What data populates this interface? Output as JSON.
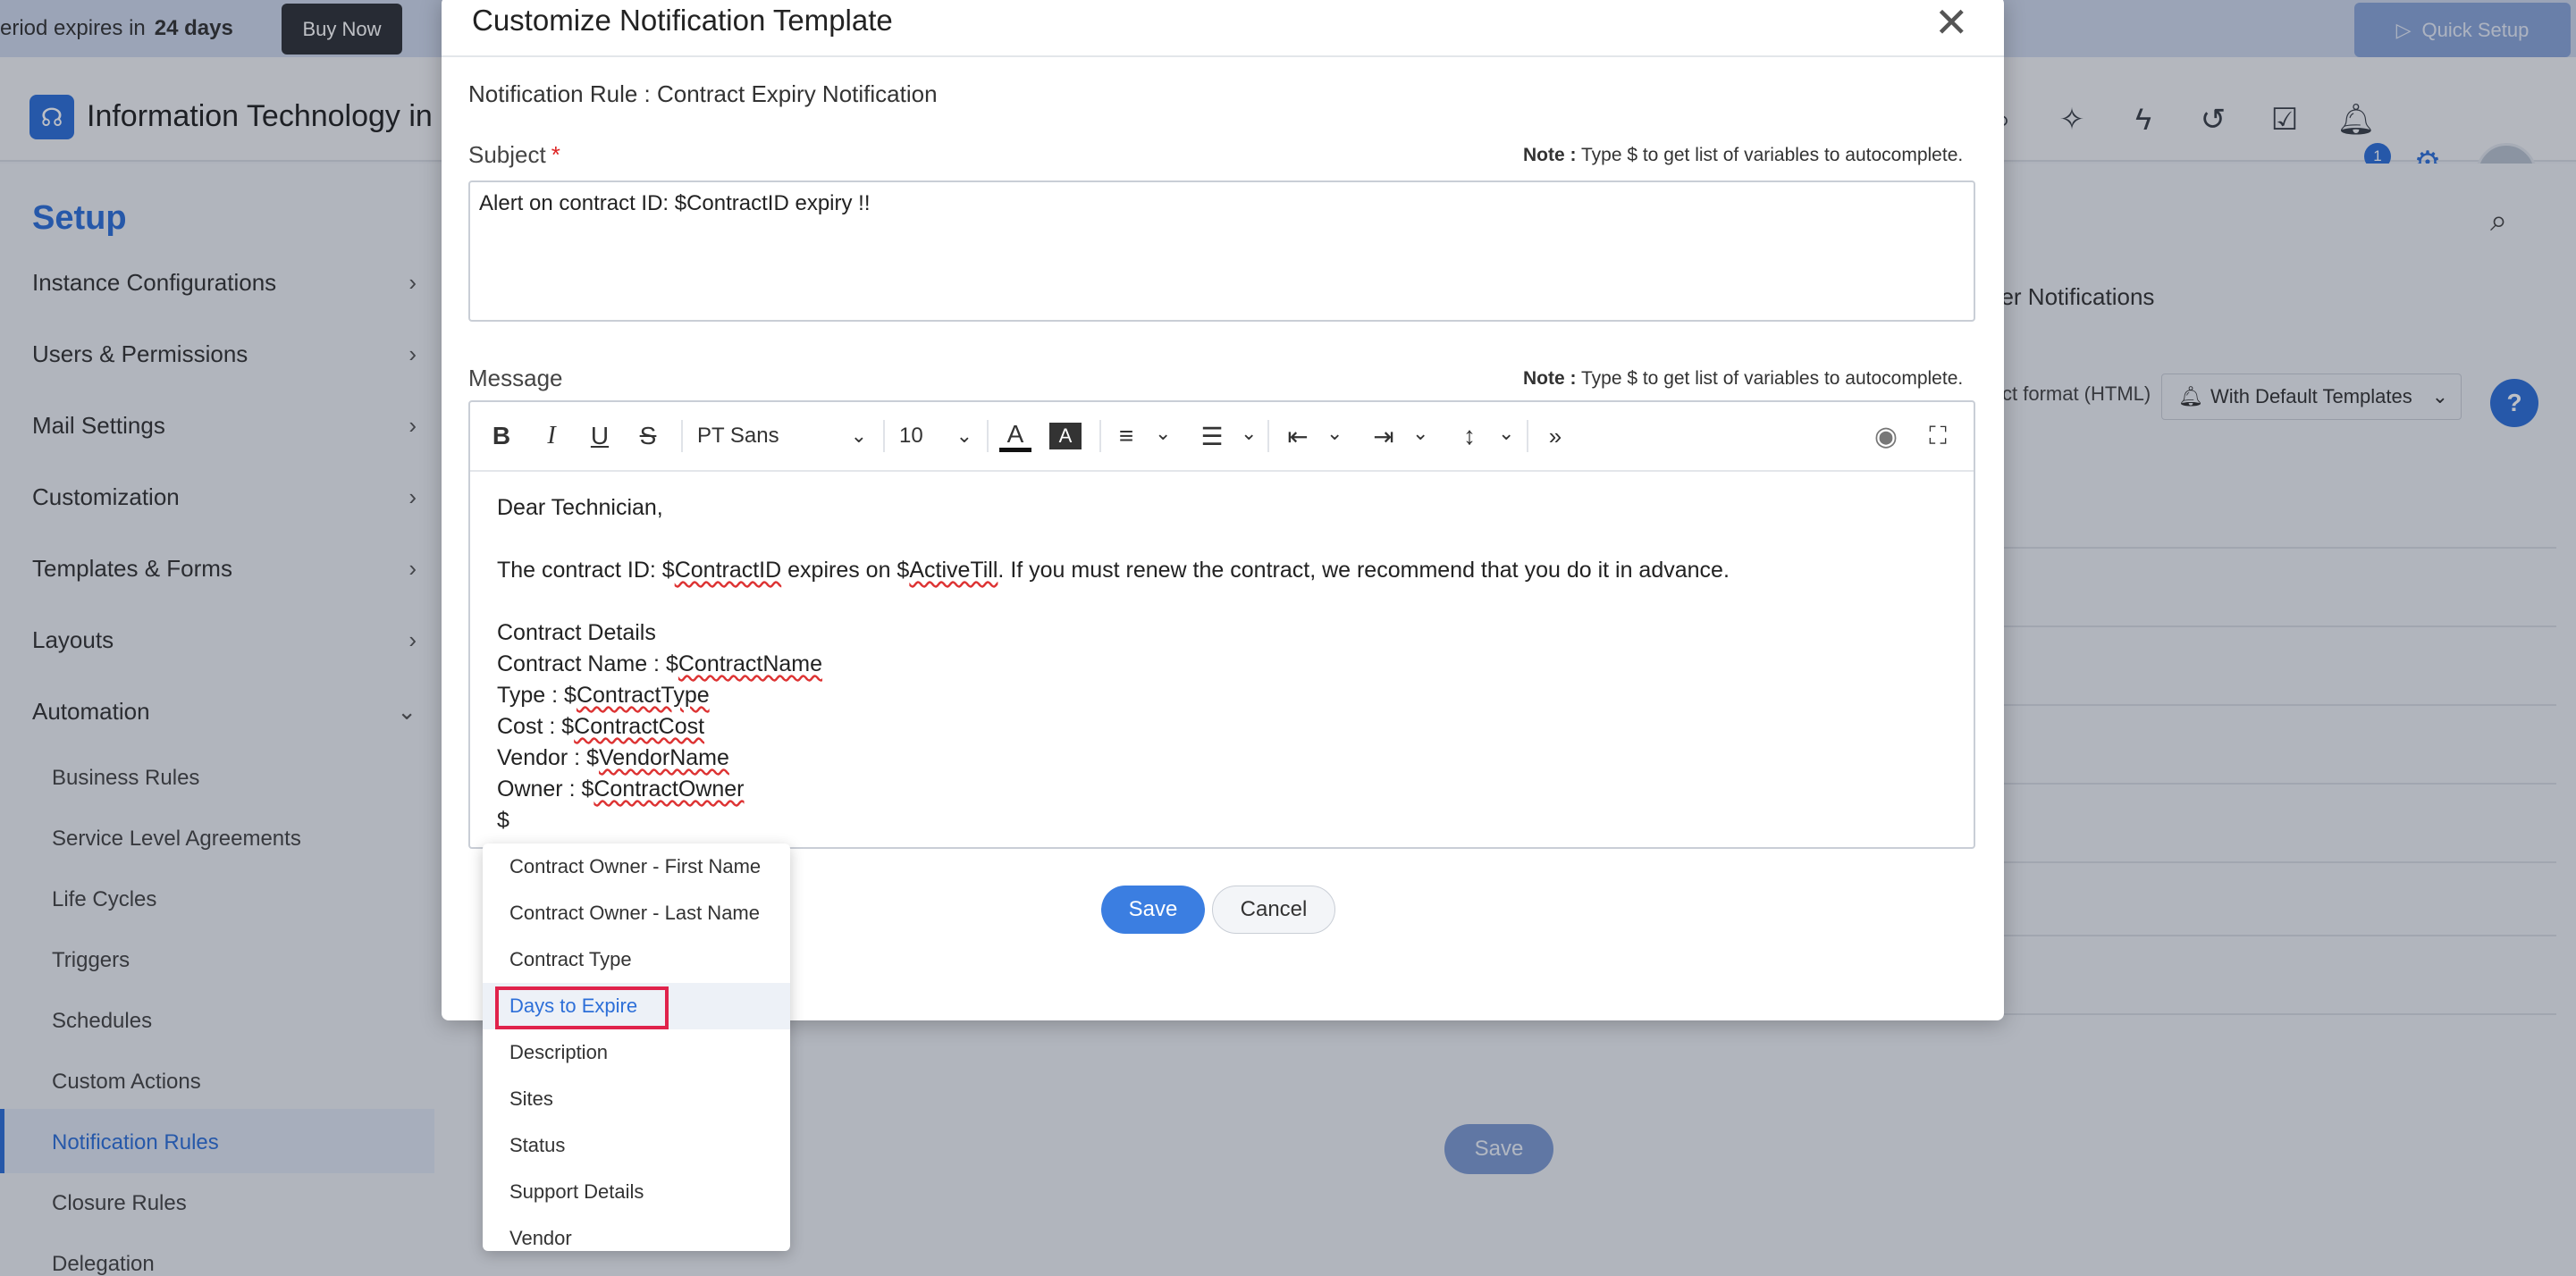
{
  "trial": {
    "text": "eriod expires in",
    "days": "24 days",
    "buy_now": "Buy Now",
    "quick_setup": "Quick Setup"
  },
  "header": {
    "app_title": "Information Technology in",
    "notification_count": "1"
  },
  "sidebar": {
    "title": "Setup",
    "items": [
      {
        "label": "Instance Configurations"
      },
      {
        "label": "Users & Permissions"
      },
      {
        "label": "Mail Settings"
      },
      {
        "label": "Customization"
      },
      {
        "label": "Templates & Forms"
      },
      {
        "label": "Layouts"
      },
      {
        "label": "Automation"
      }
    ],
    "sub_items": [
      {
        "label": "Business Rules"
      },
      {
        "label": "Service Level Agreements"
      },
      {
        "label": "Life Cycles"
      },
      {
        "label": "Triggers"
      },
      {
        "label": "Schedules"
      },
      {
        "label": "Custom Actions"
      },
      {
        "label": "Notification Rules"
      },
      {
        "label": "Closure Rules"
      },
      {
        "label": "Delegation"
      }
    ]
  },
  "main": {
    "tab_text": "her Notifications",
    "format_text": "ct format (HTML)",
    "template_select": "With Default Templates",
    "help": "?",
    "save_label": "Save"
  },
  "modal": {
    "title": "Customize Notification Template",
    "close": "✕",
    "rule_line": "Notification Rule : Contract Expiry Notification",
    "subject_label": "Subject",
    "required_mark": "*",
    "note_label": "Note :",
    "note_text": "Type $ to get list of variables to autocomplete.",
    "subject_value": "Alert on contract ID: $ContractID expiry !!",
    "message_label": "Message",
    "toolbar": {
      "font_family": "PT Sans",
      "font_size": "10"
    },
    "body": {
      "greeting": "Dear Technician,",
      "line1_a": "The contract ID: $",
      "line1_var1": "ContractID",
      "line1_b": " expires on $",
      "line1_var2": "ActiveTill",
      "line1_c": ". If you must renew the contract, we recommend that you do it in advance.",
      "details_heading": "Contract Details",
      "name_label": "Contract Name : $",
      "name_var": "ContractName",
      "type_label": "Type : $",
      "type_var": "ContractType",
      "cost_label": "Cost : $",
      "cost_var": "ContractCost",
      "vendor_label": "Vendor : $",
      "vendor_var": "VendorName",
      "owner_label": "Owner : $",
      "owner_var": "ContractOwner",
      "cursor_line": "$"
    },
    "save_label": "Save",
    "cancel_label": "Cancel"
  },
  "autocomplete": {
    "items": [
      {
        "label": "Contract Owner - First Name"
      },
      {
        "label": "Contract Owner - Last Name"
      },
      {
        "label": "Contract Type"
      },
      {
        "label": "Days to Expire"
      },
      {
        "label": "Description"
      },
      {
        "label": "Sites"
      },
      {
        "label": "Status"
      },
      {
        "label": "Support Details"
      },
      {
        "label": "Vendor"
      }
    ],
    "highlighted": "Days to Expire"
  },
  "colors": {
    "accent": "#2d6fd8",
    "focus_outline": "#e0234b",
    "save_button": "#3b7ee1"
  }
}
